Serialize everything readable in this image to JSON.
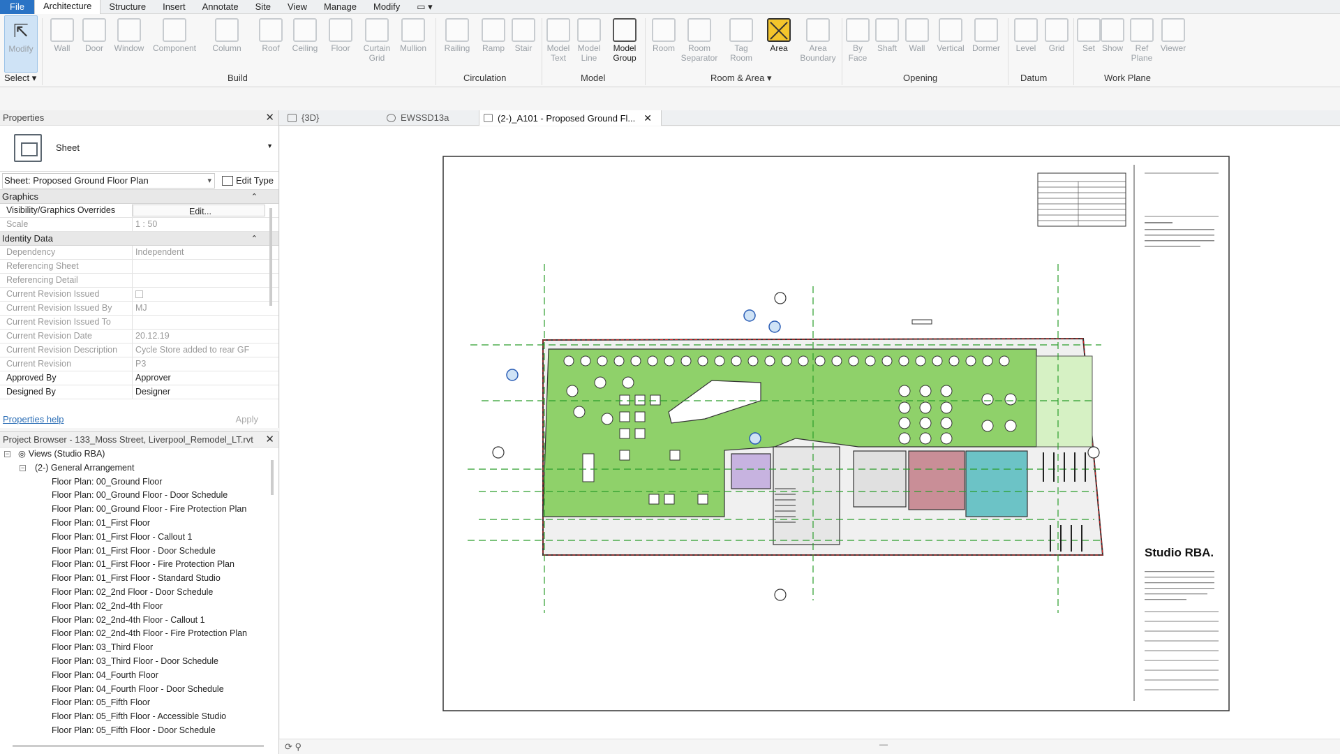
{
  "menubar": {
    "items": [
      "File",
      "Architecture",
      "Structure",
      "Insert",
      "Annotate",
      "Site",
      "View",
      "Manage",
      "Modify"
    ]
  },
  "ribbon": {
    "select_label": "Select",
    "panels": [
      "Build",
      "Circulation",
      "Model",
      "Room & Area",
      "Opening",
      "Datum",
      "Work Plane"
    ],
    "tools": [
      {
        "label": "Modify",
        "l2": ""
      },
      {
        "label": "Wall",
        "l2": ""
      },
      {
        "label": "Door",
        "l2": ""
      },
      {
        "label": "Window",
        "l2": ""
      },
      {
        "label": "Component",
        "l2": ""
      },
      {
        "label": "Column",
        "l2": ""
      },
      {
        "label": "Roof",
        "l2": ""
      },
      {
        "label": "Ceiling",
        "l2": ""
      },
      {
        "label": "Floor",
        "l2": ""
      },
      {
        "label": "Curtain",
        "l2": "Grid"
      },
      {
        "label": "Mullion",
        "l2": ""
      },
      {
        "label": "Railing",
        "l2": ""
      },
      {
        "label": "Ramp",
        "l2": ""
      },
      {
        "label": "Stair",
        "l2": ""
      },
      {
        "label": "Model",
        "l2": "Text"
      },
      {
        "label": "Model",
        "l2": "Line"
      },
      {
        "label": "Model",
        "l2": "Group"
      },
      {
        "label": "Room",
        "l2": ""
      },
      {
        "label": "Room",
        "l2": "Separator"
      },
      {
        "label": "Tag",
        "l2": "Room"
      },
      {
        "label": "Area",
        "l2": ""
      },
      {
        "label": "Area",
        "l2": "Boundary"
      },
      {
        "label": "By",
        "l2": "Face"
      },
      {
        "label": "Shaft",
        "l2": ""
      },
      {
        "label": "Wall",
        "l2": ""
      },
      {
        "label": "Vertical",
        "l2": ""
      },
      {
        "label": "Dormer",
        "l2": ""
      },
      {
        "label": "Level",
        "l2": ""
      },
      {
        "label": "Grid",
        "l2": ""
      },
      {
        "label": "Set",
        "l2": ""
      },
      {
        "label": "Show",
        "l2": ""
      },
      {
        "label": "Ref",
        "l2": "Plane"
      },
      {
        "label": "Viewer",
        "l2": ""
      }
    ]
  },
  "properties": {
    "title": "Properties",
    "type_name": "Sheet",
    "instance_selector": "Sheet: Proposed Ground Floor Plan",
    "edit_type": "Edit Type",
    "groups": {
      "graphics": "Graphics",
      "identity": "Identity Data"
    },
    "graphics_rows": [
      {
        "k": "Visibility/Graphics Overrides",
        "v": "Edit..."
      },
      {
        "k": "Scale",
        "v": "1 : 50"
      }
    ],
    "identity_rows": [
      {
        "k": "Dependency",
        "v": "Independent"
      },
      {
        "k": "Referencing Sheet",
        "v": ""
      },
      {
        "k": "Referencing Detail",
        "v": ""
      },
      {
        "k": "Current Revision Issued",
        "v": ""
      },
      {
        "k": "Current Revision Issued By",
        "v": "MJ"
      },
      {
        "k": "Current Revision Issued To",
        "v": ""
      },
      {
        "k": "Current Revision Date",
        "v": "20.12.19"
      },
      {
        "k": "Current Revision Description",
        "v": "Cycle Store added to rear GF"
      },
      {
        "k": "Current Revision",
        "v": "P3"
      },
      {
        "k": "Approved By",
        "v": "Approver"
      },
      {
        "k": "Designed By",
        "v": "Designer"
      }
    ],
    "help_link": "Properties help",
    "apply": "Apply"
  },
  "browser": {
    "title": "Project Browser - 133_Moss Street, Liverpool_Remodel_LT.rvt",
    "root": "Views (Studio RBA)",
    "group": "(2-) General Arrangement",
    "items": [
      "Floor Plan: 00_Ground Floor",
      "Floor Plan: 00_Ground Floor - Door Schedule",
      "Floor Plan: 00_Ground Floor - Fire Protection Plan",
      "Floor Plan: 01_First Floor",
      "Floor Plan: 01_First Floor - Callout 1",
      "Floor Plan: 01_First Floor - Door Schedule",
      "Floor Plan: 01_First Floor - Fire Protection Plan",
      "Floor Plan: 01_First Floor - Standard Studio",
      "Floor Plan: 02_2nd Floor - Door Schedule",
      "Floor Plan: 02_2nd-4th Floor",
      "Floor Plan: 02_2nd-4th Floor - Callout 1",
      "Floor Plan: 02_2nd-4th Floor - Fire Protection Plan",
      "Floor Plan: 03_Third Floor",
      "Floor Plan: 03_Third Floor - Door Schedule",
      "Floor Plan: 04_Fourth Floor",
      "Floor Plan: 04_Fourth Floor - Door Schedule",
      "Floor Plan: 05_Fifth Floor",
      "Floor Plan: 05_Fifth Floor - Accessible Studio",
      "Floor Plan: 05_Fifth Floor - Door Schedule"
    ]
  },
  "tabs": {
    "t1": "{3D}",
    "t2": "EWSSD13a",
    "t3": "(2-)_A101 - Proposed Ground Fl..."
  },
  "titleblock": {
    "studio": "Studio RBA."
  },
  "colors": {
    "accent": "#2a73c5",
    "planting": "#8fd16a",
    "area_yellow": "#f3c52b",
    "room_purple": "#c7b3e0",
    "room_red": "#c98e97",
    "room_teal": "#6cc3c6"
  }
}
